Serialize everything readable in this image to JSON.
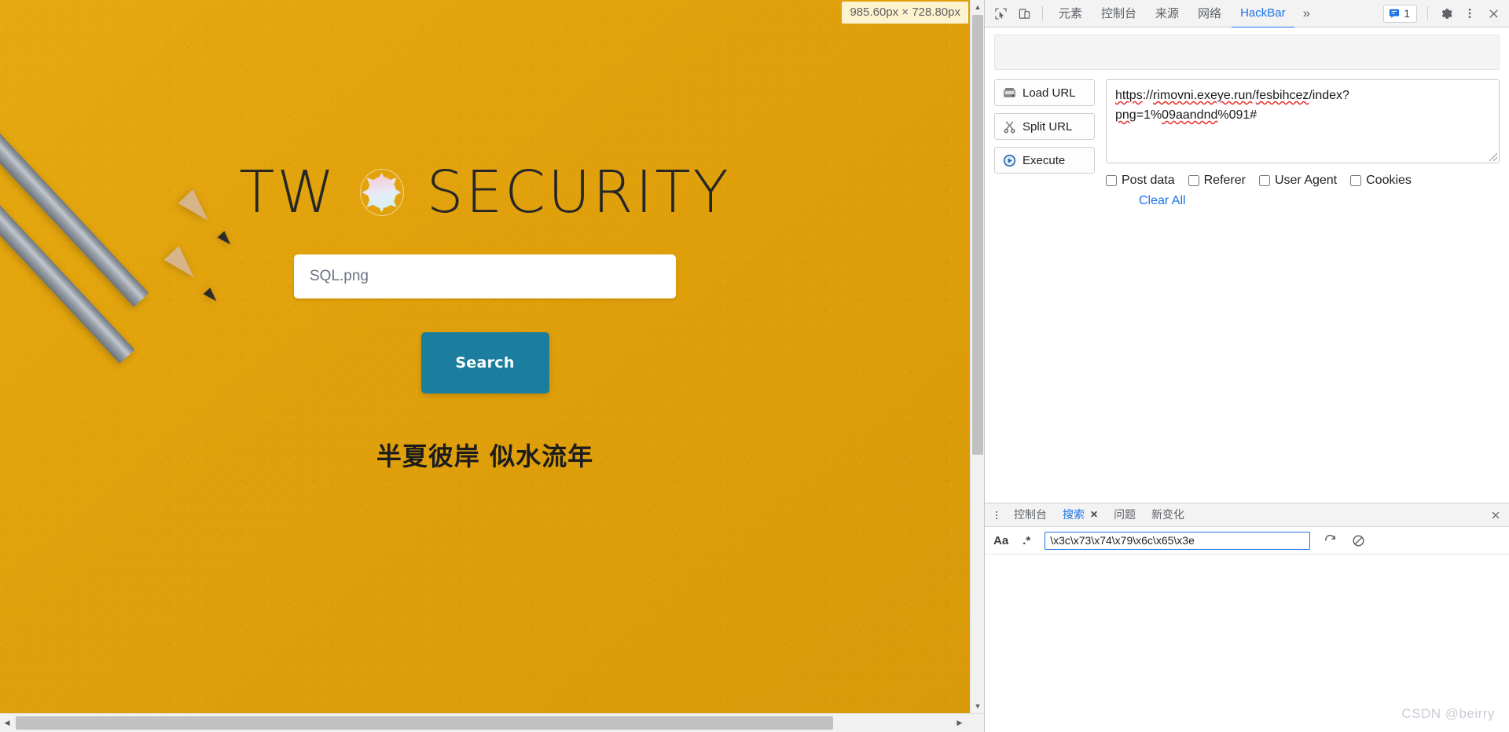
{
  "page": {
    "brand": {
      "prefix": "TW",
      "suffix": "SECURITY",
      "logo_icon": "star-badge-icon"
    },
    "search_input_value": "SQL.png",
    "search_input_placeholder": "SQL.png",
    "search_button_label": "Search",
    "tagline": "半夏彼岸 似水流年",
    "background_color": "#e2a30c",
    "button_color": "#1b7e9e"
  },
  "inspect_badge": {
    "size_text": "985.60px × 728.80px"
  },
  "devtools": {
    "toolbar": {
      "inspect_icon": "cursor-select-icon",
      "device_icon": "device-toolbar-icon",
      "tabs": [
        {
          "label": "元素",
          "active": false
        },
        {
          "label": "控制台",
          "active": false
        },
        {
          "label": "来源",
          "active": false
        },
        {
          "label": "网络",
          "active": false
        },
        {
          "label": "HackBar",
          "active": true
        }
      ],
      "more_tabs_icon": "chevron-double-right-icon",
      "message_count": "1",
      "message_icon": "message-icon",
      "settings_icon": "gear-icon",
      "kebab_icon": "more-vertical-icon",
      "close_icon": "close-icon",
      "accent_color": "#1a73e8"
    },
    "hackbar": {
      "buttons": [
        {
          "label": "Load URL",
          "icon": "load-url-icon"
        },
        {
          "label": "Split URL",
          "icon": "split-url-icon"
        },
        {
          "label": "Execute",
          "icon": "execute-icon"
        }
      ],
      "url_parts": [
        {
          "text": "https",
          "spell": true
        },
        {
          "text": "://",
          "spell": false
        },
        {
          "text": "rimovni.exeye.run",
          "spell": true
        },
        {
          "text": "/",
          "spell": false
        },
        {
          "text": "fesbihcez",
          "spell": true
        },
        {
          "text": "/index?",
          "spell": false
        },
        {
          "text": "png",
          "spell": true
        },
        {
          "text": "=1%",
          "spell": false
        },
        {
          "text": "09aandnd",
          "spell": true
        },
        {
          "text": "%091#",
          "spell": false
        }
      ],
      "url_value": "https://rimovni.exeye.run/fesbihcez/index?png=1%09aandnd%091#",
      "checkboxes": [
        {
          "label": "Post data",
          "checked": false
        },
        {
          "label": "Referer",
          "checked": false
        },
        {
          "label": "User Agent",
          "checked": false
        },
        {
          "label": "Cookies",
          "checked": false
        }
      ],
      "clear_all_label": "Clear All"
    },
    "drawer": {
      "kebab_icon": "more-vertical-icon",
      "tabs": [
        {
          "label": "控制台",
          "active": false,
          "closable": false
        },
        {
          "label": "搜索",
          "active": true,
          "closable": true
        },
        {
          "label": "问题",
          "active": false,
          "closable": false
        },
        {
          "label": "新变化",
          "active": false,
          "closable": false
        }
      ],
      "close_icon": "close-icon",
      "search": {
        "match_case_label": "Aa",
        "regex_label": ".*",
        "value": "\\x3c\\x73\\x74\\x79\\x6c\\x65\\x3e",
        "refresh_icon": "refresh-icon",
        "clear_icon": "clear-icon"
      }
    }
  },
  "watermark": "CSDN @beirry"
}
